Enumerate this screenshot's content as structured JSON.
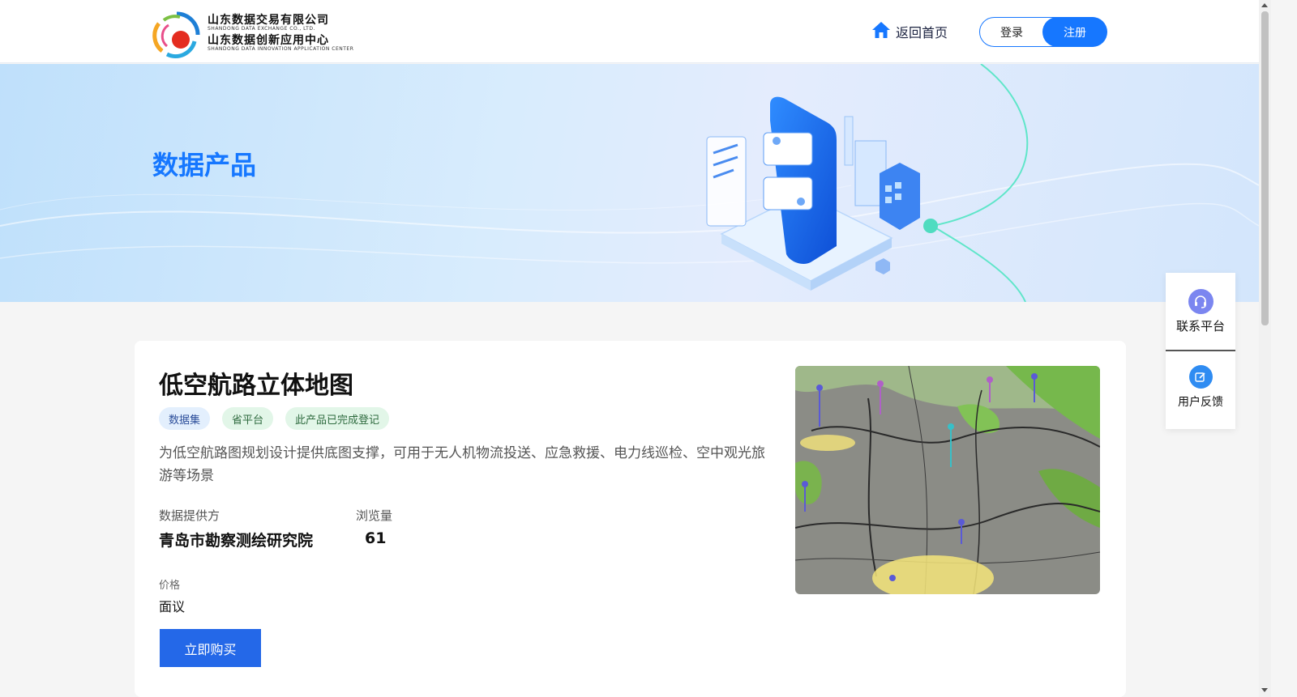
{
  "header": {
    "logo": {
      "cn_line1": "山东数据交易有限公司",
      "en_line1": "SHANDONG DATA EXCHANGE CO., LTD.",
      "cn_line2": "山东数据创新应用中心",
      "en_line2": "SHANDONG DATA INNOVATION APPLICATION CENTER"
    },
    "home_label": "返回首页",
    "login_label": "登录",
    "register_label": "注册"
  },
  "banner": {
    "title": "数据产品"
  },
  "product": {
    "title": "低空航路立体地图",
    "tags": [
      "数据集",
      "省平台",
      "此产品已完成登记"
    ],
    "description": "为低空航路图规划设计提供底图支撑，可用于无人机物流投送、应急救援、电力线巡检、空中观光旅游等场景",
    "provider_label": "数据提供方",
    "provider_value": "青岛市勘察测绘研究院",
    "views_label": "浏览量",
    "views_value": "61",
    "price_label": "价格",
    "price_value": "面议",
    "buy_label": "立即购买"
  },
  "side_panel": {
    "contact_label": "联系平台",
    "feedback_label": "用户反馈"
  },
  "colors": {
    "primary": "#1677ff",
    "buy_button": "#2468e8",
    "tag_blue_bg": "#e3effd",
    "tag_green_bg": "#e2f6e8"
  }
}
